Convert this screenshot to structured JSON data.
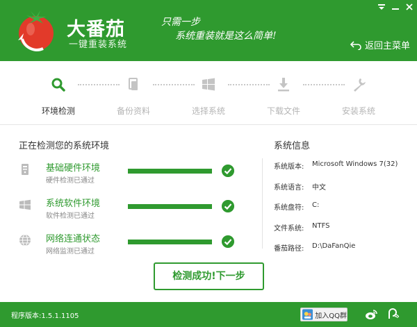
{
  "colors": {
    "brand_green": "#2f9a2f",
    "tomato_red": "#e23a2a"
  },
  "header": {
    "title": "大番茄",
    "subtitle": "一键重装系统",
    "slogan_line1": "只需一步",
    "slogan_line2": "系统重装就是这么简单!",
    "back_label": "返回主菜单",
    "window_icons": [
      "menu-icon",
      "minimize-icon",
      "close-icon"
    ]
  },
  "steps": [
    {
      "label": "环境检测",
      "icon": "search-icon",
      "active": true
    },
    {
      "label": "备份资料",
      "icon": "copy-icon",
      "active": false
    },
    {
      "label": "选择系统",
      "icon": "windows-icon",
      "active": false
    },
    {
      "label": "下载文件",
      "icon": "download-icon",
      "active": false
    },
    {
      "label": "安装系统",
      "icon": "wrench-icon",
      "active": false
    }
  ],
  "detection": {
    "title": "正在检测您的系统环境",
    "items": [
      {
        "name": "基础硬件环境",
        "desc": "硬件检测已通过",
        "icon": "hardware-icon",
        "progress": 1.0
      },
      {
        "name": "系统软件环境",
        "desc": "软件检测已通过",
        "icon": "windows-icon",
        "progress": 1.0
      },
      {
        "name": "网络连通状态",
        "desc": "网络监测已通过",
        "icon": "globe-icon",
        "progress": 1.0
      }
    ]
  },
  "next_button": "检测成功!下一步",
  "sysinfo": {
    "title": "系统信息",
    "rows": [
      {
        "key": "系统版本:",
        "value": "Microsoft Windows 7(32)"
      },
      {
        "key": "系统语言:",
        "value": "中文"
      },
      {
        "key": "系统盘符:",
        "value": "C:"
      },
      {
        "key": "文件系统:",
        "value": "NTFS"
      },
      {
        "key": "番茄路径:",
        "value": "D:\\DaFanQie"
      }
    ]
  },
  "footer": {
    "version": "程序版本:1.5.1.1105",
    "qq_label": "加入QQ群",
    "icons": [
      "weibo-icon",
      "support-icon"
    ]
  }
}
